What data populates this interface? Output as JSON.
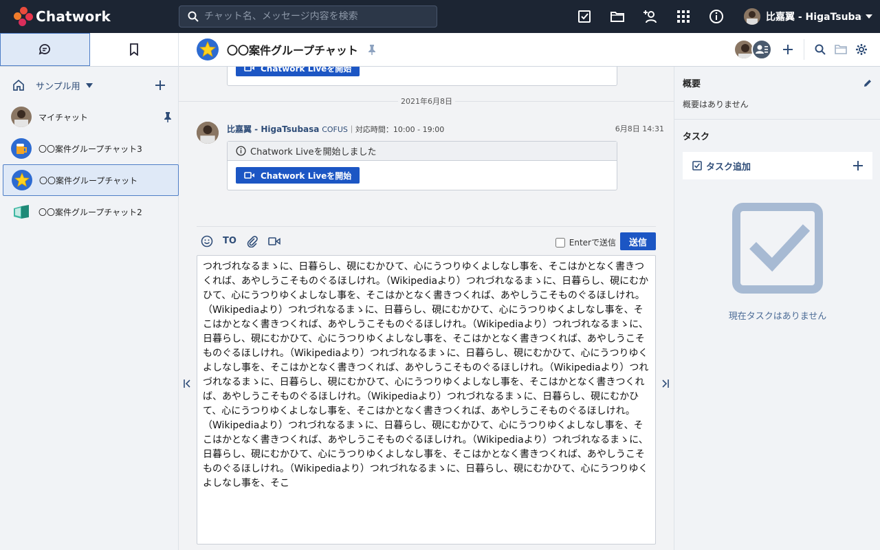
{
  "app": {
    "name": "Chatwork"
  },
  "search": {
    "placeholder": "チャット名、メッセージ内容を検索"
  },
  "user": {
    "name": "比嘉翼 - HigaTsubasa"
  },
  "sidebar": {
    "group": {
      "label": "サンプル用"
    },
    "rooms": [
      {
        "name": "マイチャット",
        "pinned": true,
        "icon": "person-avatar"
      },
      {
        "name": "〇〇案件グループチャット3",
        "icon": "beer-icon"
      },
      {
        "name": "〇〇案件グループチャット",
        "icon": "star-icon",
        "active": true
      },
      {
        "name": "〇〇案件グループチャット2",
        "icon": "book-icon"
      }
    ]
  },
  "room": {
    "title": "〇〇案件グループチャット"
  },
  "timeline": {
    "prev_live_button": "Chatwork Liveを開始",
    "date": "2021年6月8日",
    "message": {
      "sender": "比嘉翼 - HigaTsubasa",
      "org": "COFUS",
      "hours": "｜対応時間：10:00 - 19:00",
      "time": "6月8日 14:31",
      "live_notice": "Chatwork Liveを開始しました",
      "live_button": "Chatwork Liveを開始"
    }
  },
  "composer": {
    "to_label": "TO",
    "enter_send_label": "Enterで送信",
    "send_label": "送信",
    "text": "つれづれなるまゝに、日暮らし、硯にむかひて、心にうつりゆくよしなし事を、そこはかとなく書きつくれば、あやしうこそものぐるほしけれ。（Wikipediaより）つれづれなるまゝに、日暮らし、硯にむかひて、心にうつりゆくよしなし事を、そこはかとなく書きつくれば、あやしうこそものぐるほしけれ。（Wikipediaより）つれづれなるまゝに、日暮らし、硯にむかひて、心にうつりゆくよしなし事を、そこはかとなく書きつくれば、あやしうこそものぐるほしけれ。（Wikipediaより）つれづれなるまゝに、日暮らし、硯にむかひて、心にうつりゆくよしなし事を、そこはかとなく書きつくれば、あやしうこそものぐるほしけれ。（Wikipediaより）つれづれなるまゝに、日暮らし、硯にむかひて、心にうつりゆくよしなし事を、そこはかとなく書きつくれば、あやしうこそものぐるほしけれ。（Wikipediaより）つれづれなるまゝに、日暮らし、硯にむかひて、心にうつりゆくよしなし事を、そこはかとなく書きつくれば、あやしうこそものぐるほしけれ。（Wikipediaより）つれづれなるまゝに、日暮らし、硯にむかひて、心にうつりゆくよしなし事を、そこはかとなく書きつくれば、あやしうこそものぐるほしけれ。（Wikipediaより）つれづれなるまゝに、日暮らし、硯にむかひて、心にうつりゆくよしなし事を、そこはかとなく書きつくれば、あやしうこそものぐるほしけれ。（Wikipediaより）つれづれなるまゝに、日暮らし、硯にむかひて、心にうつりゆくよしなし事を、そこはかとなく書きつくれば、あやしうこそものぐるほしけれ。（Wikipediaより）つれづれなるまゝに、日暮らし、硯にむかひて、心にうつりゆくよしなし事を、そこ"
  },
  "right_panel": {
    "overview_title": "概要",
    "overview_text": "概要はありません",
    "task_title": "タスク",
    "task_add_label": "タスク追加",
    "task_empty": "現在タスクはありません"
  },
  "colors": {
    "header_bg": "#1c2533",
    "accent": "#1c56c4",
    "link": "#2f4d78"
  }
}
